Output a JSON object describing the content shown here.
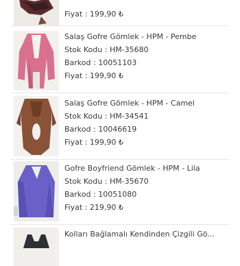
{
  "products": [
    {
      "name": "",
      "stock_code": "",
      "barcode": "",
      "price": "Fiyat : 199,90 ₺"
    },
    {
      "name": "Salaş Gofre Gömlek - HPM - Pembe",
      "stock_code": "Stok Kodu : HM-35680",
      "barcode": "Barkod : 10051103",
      "price": "Fiyat : 199,90 ₺"
    },
    {
      "name": "Salaş Gofre Gömlek - HPM - Camel",
      "stock_code": "Stok Kodu : HM-34541",
      "barcode": "Barkod : 10046619",
      "price": "Fiyat : 199,90 ₺"
    },
    {
      "name": "Gofre Boyfriend Gömlek - HPM - Lila",
      "stock_code": "Stok Kodu : HM-35670",
      "barcode": "Barkod : 10051080",
      "price": "Fiyat : 219,90 ₺"
    },
    {
      "name": "Kolları Bağlamalı Kendinden Çizgili Gö...",
      "stock_code": "",
      "barcode": "",
      "price": ""
    }
  ],
  "colors": {
    "divider": "#e6e6e6",
    "text": "#3a3a3a"
  },
  "icons": [
    "product-photo-dark",
    "product-photo-pink",
    "product-photo-camel",
    "product-photo-lilac",
    "product-photo-striped"
  ]
}
